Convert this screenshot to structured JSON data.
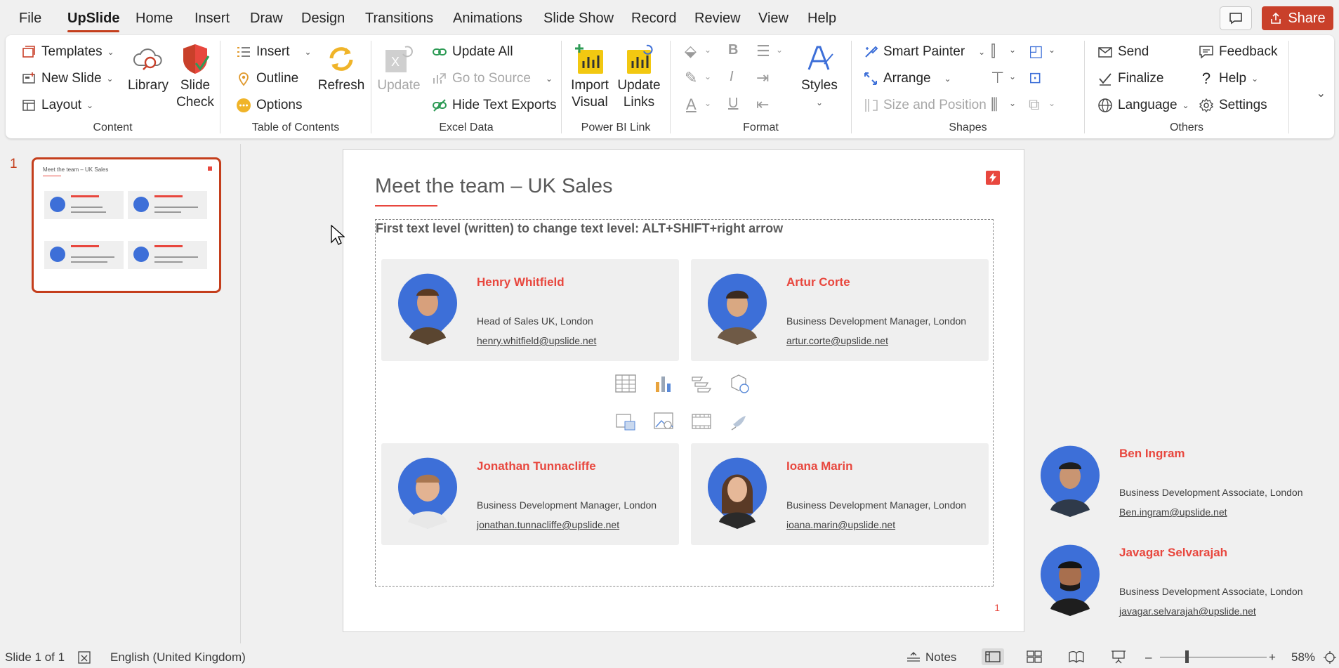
{
  "menu": {
    "tabs": [
      "File",
      "UpSlide",
      "Home",
      "Insert",
      "Draw",
      "Design",
      "Transitions",
      "Animations",
      "Slide Show",
      "Record",
      "Review",
      "View",
      "Help"
    ],
    "active_tab": "UpSlide",
    "share_label": "Share"
  },
  "ribbon": {
    "content": {
      "label": "Content",
      "templates": "Templates",
      "new_slide": "New Slide",
      "layout": "Layout",
      "library": "Library",
      "slide_check_line1": "Slide",
      "slide_check_line2": "Check"
    },
    "toc": {
      "label": "Table of Contents",
      "insert": "Insert",
      "outline": "Outline",
      "options": "Options",
      "refresh": "Refresh"
    },
    "excel": {
      "label": "Excel Data",
      "update": "Update",
      "update_all": "Update All",
      "go_to_source": "Go to Source",
      "hide_text_exports": "Hide Text Exports"
    },
    "powerbi": {
      "label": "Power BI Link",
      "import_line1": "Import",
      "import_line2": "Visual",
      "update_line1": "Update",
      "update_line2": "Links"
    },
    "format": {
      "label": "Format",
      "styles": "Styles"
    },
    "shapes": {
      "label": "Shapes",
      "smart_painter": "Smart Painter",
      "arrange": "Arrange",
      "size_position": "Size and Position"
    },
    "others": {
      "label": "Others",
      "send": "Send",
      "finalize": "Finalize",
      "language": "Language",
      "feedback": "Feedback",
      "help": "Help",
      "settings": "Settings"
    }
  },
  "thumbnails": [
    {
      "number": "1",
      "title": "Meet the team – UK Sales"
    }
  ],
  "slide": {
    "title": "Meet the team – UK Sales",
    "placeholder_text": "First text level (written) to change text level: ALT+SHIFT+right arrow",
    "page_number": "1",
    "cards": [
      {
        "name": "Henry Whitfield",
        "role": "Head of Sales UK, London",
        "email": "henry.whitfield@upslide.net"
      },
      {
        "name": "Artur Corte",
        "role": "Business Development Manager, London",
        "email": "artur.corte@upslide.net"
      },
      {
        "name": "Jonathan Tunnacliffe",
        "role": "Business Development Manager, London",
        "email": "jonathan.tunnacliffe@upslide.net"
      },
      {
        "name": "Ioana Marin",
        "role": "Business Development Manager, London",
        "email": "ioana.marin@upslide.net"
      }
    ],
    "offslide": [
      {
        "name": "Ben Ingram",
        "role": "Business Development Associate, London",
        "email": "Ben.ingram@upslide.net"
      },
      {
        "name": "Javagar Selvarajah",
        "role": "Business Development Associate, London",
        "email": "javagar.selvarajah@upslide.net"
      }
    ]
  },
  "status": {
    "slide_counter": "Slide 1 of 1",
    "language": "English (United Kingdom)",
    "notes": "Notes",
    "zoom_out": "–",
    "zoom_in": "+",
    "zoom": "58%"
  },
  "colors": {
    "accent": "#c43e1c",
    "brand_red": "#e8473e",
    "avatar_blue": "#3d6fd8",
    "card_bg": "#efefef"
  }
}
